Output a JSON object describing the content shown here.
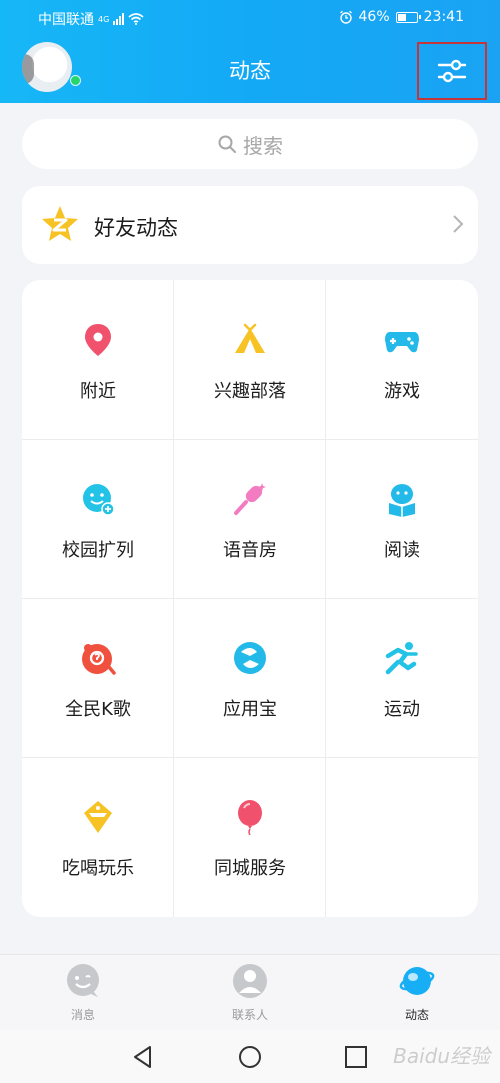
{
  "status_bar": {
    "carrier": "中国联通",
    "network": "4G",
    "battery": "46%",
    "battery_level": 0.46,
    "time": "23:41"
  },
  "header": {
    "title": "动态"
  },
  "search": {
    "placeholder": "搜索"
  },
  "friends": {
    "label": "好友动态"
  },
  "grid": {
    "items": [
      {
        "label": "附近",
        "icon": "location-pin-icon",
        "color": "#f0516d"
      },
      {
        "label": "兴趣部落",
        "icon": "tent-icon",
        "color": "#f7c224"
      },
      {
        "label": "游戏",
        "icon": "gamepad-icon",
        "color": "#23b9e8"
      },
      {
        "label": "校园扩列",
        "icon": "smile-plus-icon",
        "color": "#22c3e6"
      },
      {
        "label": "语音房",
        "icon": "microphone-icon",
        "color": "#f37bc2"
      },
      {
        "label": "阅读",
        "icon": "book-reader-icon",
        "color": "#23b9e8"
      },
      {
        "label": "全民K歌",
        "icon": "karaoke-icon",
        "color": "#f0513e"
      },
      {
        "label": "应用宝",
        "icon": "app-store-icon",
        "color": "#23b9e8"
      },
      {
        "label": "运动",
        "icon": "runner-icon",
        "color": "#22c3e6"
      },
      {
        "label": "吃喝玩乐",
        "icon": "bag-icon",
        "color": "#f7c224"
      },
      {
        "label": "同城服务",
        "icon": "balloon-icon",
        "color": "#f0516d"
      }
    ]
  },
  "tabs": [
    {
      "label": "消息",
      "icon": "message-icon"
    },
    {
      "label": "联系人",
      "icon": "contacts-icon"
    },
    {
      "label": "动态",
      "icon": "planet-icon"
    }
  ],
  "watermark": "Baidu经验"
}
